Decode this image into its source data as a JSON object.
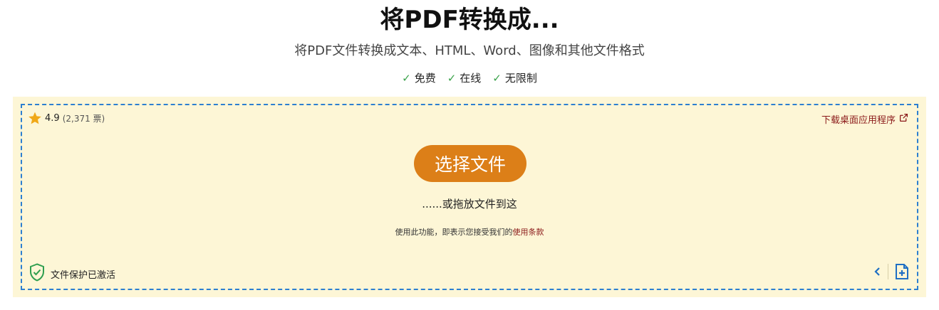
{
  "header": {
    "title": "将PDF转换成...",
    "subtitle": "将PDF文件转换成文本、HTML、Word、图像和其他文件格式",
    "features": [
      "免费",
      "在线",
      "无限制"
    ]
  },
  "upload": {
    "rating_value": "4.9",
    "rating_votes": "(2,371 票)",
    "desktop_link": "下载桌面应用程序",
    "choose_button": "选择文件",
    "drop_text": "......或拖放文件到这",
    "terms_prefix": "使用此功能，即表示您接受我们的",
    "terms_link": "使用条款",
    "protection_text": "文件保护已激活"
  },
  "colors": {
    "accent_button": "#dc7f18",
    "dashed_border": "#2c7fd0",
    "panel_bg": "#fdf6d6",
    "link": "#8b1a1a",
    "check": "#3aa34a"
  },
  "icons": [
    "star-icon",
    "external-link-icon",
    "shield-check-icon",
    "chevron-left-icon",
    "add-file-icon",
    "check-icon"
  ]
}
